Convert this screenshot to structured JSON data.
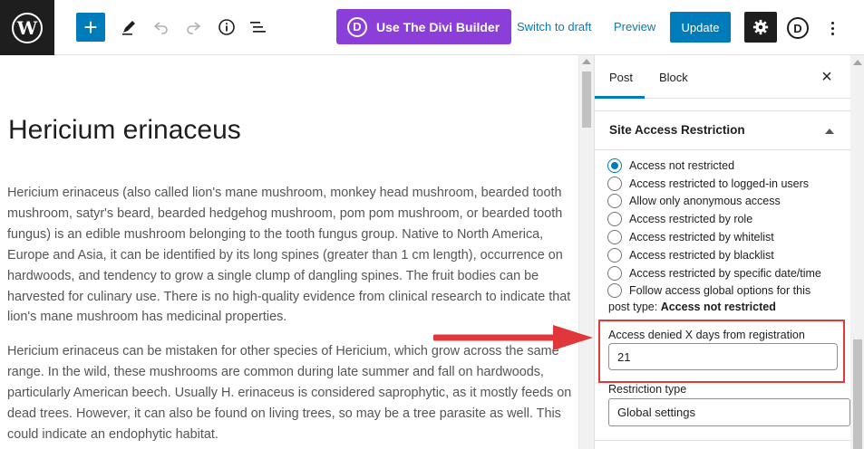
{
  "toolbar": {
    "wp_logo": "W",
    "add_icon": "+",
    "divi_button": "Use The Divi Builder",
    "divi_letter": "D",
    "switch_draft": "Switch to draft",
    "preview": "Preview",
    "update": "Update",
    "divi_mark": "D"
  },
  "editor": {
    "title": "Hericium erinaceus",
    "paragraph1": "Hericium erinaceus (also called lion's mane mushroom, monkey head mushroom, bearded tooth mushroom, satyr's beard, bearded hedgehog mushroom, pom pom mushroom, or bearded tooth fungus) is an edible mushroom belonging to the tooth fungus group. Native to North America, Europe and Asia, it can be identified by its long spines (greater than 1 cm length), occurrence on hardwoods, and tendency to grow a single clump of dangling spines. The fruit bodies can be harvested for culinary use. There is no high-quality evidence from clinical research to indicate that lion's mane mushroom has medicinal properties.",
    "paragraph2": "Hericium erinaceus can be mistaken for other species of Hericium, which grow across the same range. In the wild, these mushrooms are common during late summer and fall on hardwoods, particularly American beech. Usually H. erinaceus is considered saprophytic, as it mostly feeds on dead trees. However, it can also be found on living trees, so may be a tree parasite as well. This could indicate an endophytic habitat."
  },
  "sidebar": {
    "tabs": [
      {
        "label": "Post",
        "active": true
      },
      {
        "label": "Block",
        "active": false
      }
    ],
    "close": "×",
    "panel_title": "Site Access Restriction",
    "options": [
      {
        "label": "Access not restricted",
        "checked": true
      },
      {
        "label": "Access restricted to logged-in users",
        "checked": false
      },
      {
        "label": "Allow only anonymous access",
        "checked": false
      },
      {
        "label": "Access restricted by role",
        "checked": false
      },
      {
        "label": "Access restricted by whitelist",
        "checked": false
      },
      {
        "label": "Access restricted by blacklist",
        "checked": false
      },
      {
        "label": "Access restricted by specific date/time",
        "checked": false
      },
      {
        "label": "Follow access global options for this",
        "checked": false
      }
    ],
    "post_type_prefix": "post type:",
    "post_type_value": "Access not restricted",
    "days_label": "Access denied X days from registration",
    "days_value": "21",
    "restriction_type_label": "Restriction type",
    "restriction_type_value": "Global settings"
  },
  "colors": {
    "accent": "#007cba",
    "divi": "#8c3fd8",
    "highlight": "#e1373a"
  }
}
